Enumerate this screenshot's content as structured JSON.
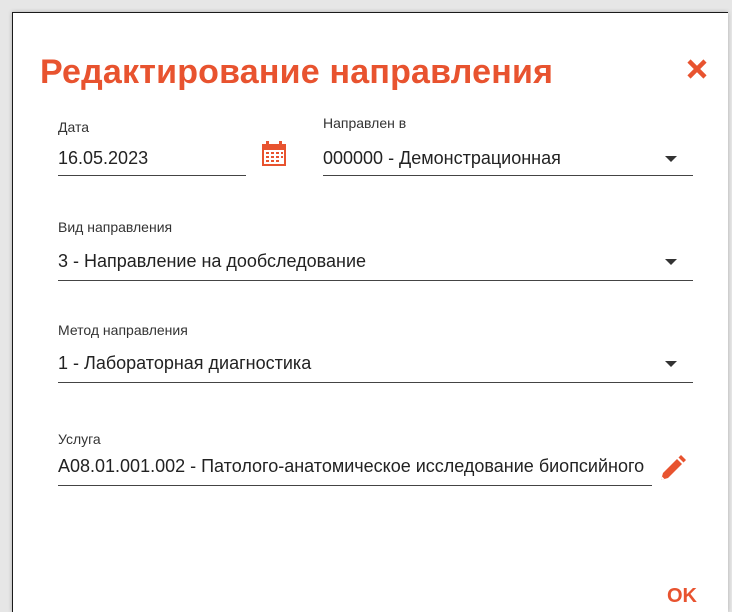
{
  "dialog": {
    "title": "Редактирование направления",
    "ok_label": "OK"
  },
  "fields": {
    "date": {
      "label": "Дата",
      "value": "16.05.2023"
    },
    "directed_to": {
      "label": "Направлен в",
      "value": "000000 - Демонстрационная"
    },
    "direction_type": {
      "label": "Вид направления",
      "value": "3 - Направление на дообследование"
    },
    "direction_method": {
      "label": "Метод направления",
      "value": "1 - Лабораторная диагностика"
    },
    "service": {
      "label": "Услуга",
      "value": "A08.01.001.002 - Патолого-анатомическое исследование биопсийного"
    }
  },
  "icons": {
    "close": "close-icon",
    "calendar": "calendar-icon",
    "dropdown": "chevron-down-icon",
    "edit": "pencil-icon"
  },
  "colors": {
    "accent": "#e8532f",
    "text": "#222222"
  }
}
